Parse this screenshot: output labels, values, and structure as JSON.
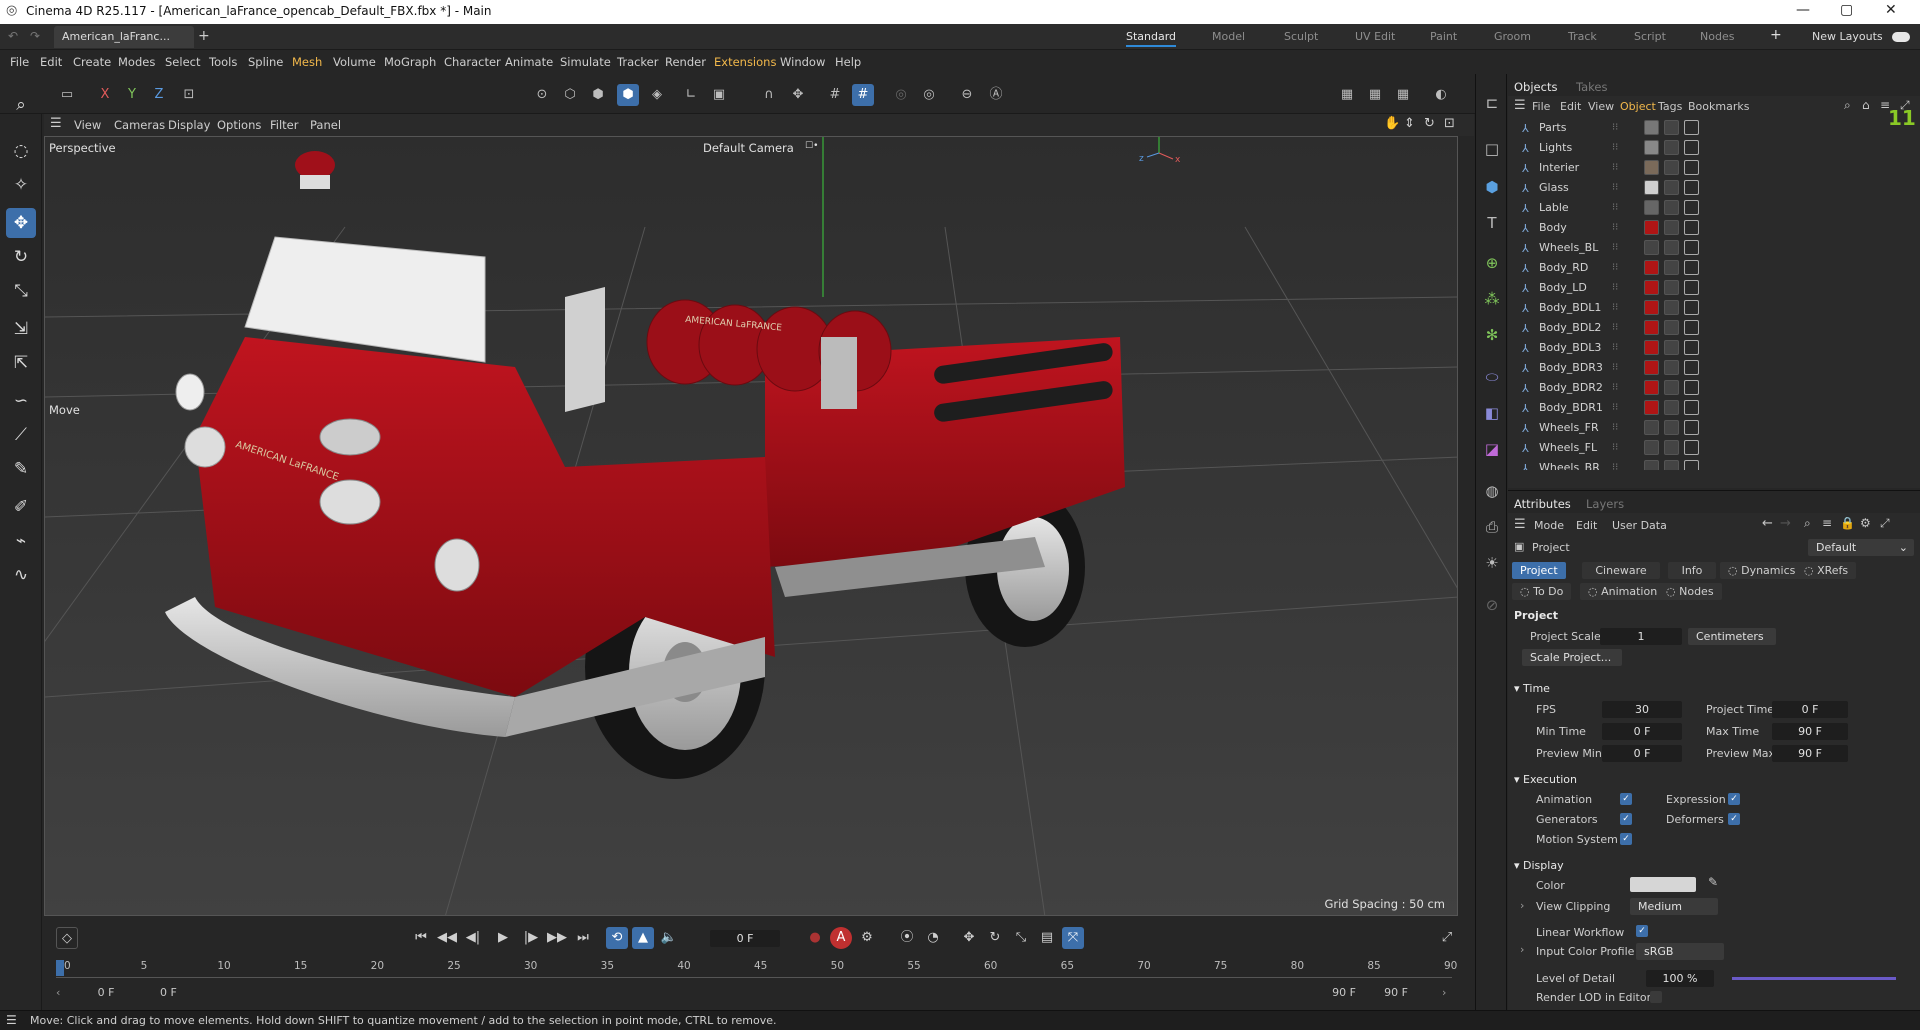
{
  "window": {
    "title": "Cinema 4D R25.117 - [American_laFrance_opencab_Default_FBX.fbx *] - Main",
    "minimize": "—",
    "maximize": "▢",
    "close": "✕"
  },
  "doc_tab": {
    "label": "American_laFranc...",
    "add": "+"
  },
  "layouts": [
    "Standard",
    "Model",
    "Sculpt",
    "UV Edit",
    "Paint",
    "Groom",
    "Track",
    "Script",
    "Nodes"
  ],
  "layouts_add": "+",
  "new_layouts": "New Layouts",
  "menu": [
    "File",
    "Edit",
    "Create",
    "Modes",
    "Select",
    "Tools",
    "Spline",
    "Mesh",
    "Volume",
    "MoGraph",
    "Character",
    "Animate",
    "Simulate",
    "Tracker",
    "Render",
    "Extensions",
    "Window",
    "Help"
  ],
  "axis_toolbar": {
    "x": "X",
    "y": "Y",
    "z": "Z"
  },
  "viewport_menu": [
    "View",
    "Cameras",
    "Display",
    "Options",
    "Filter",
    "Panel"
  ],
  "viewport": {
    "projection": "Perspective",
    "camera": "Default Camera",
    "camera_icon": "☐•",
    "tool_label": "Move",
    "grid_spacing": "Grid Spacing : 50 cm",
    "axis_x": "x",
    "axis_y": "y",
    "axis_z": "z",
    "truck_text": "AMERICAN LaFRANCE",
    "truck_text_small": "AMERICAN LaFRANCE"
  },
  "timeline": {
    "current_frame": "0 F",
    "start_field": "0 F",
    "start_field2": "0 F",
    "end_field": "90 F",
    "end_field2": "90 F",
    "ticks": [
      "0",
      "5",
      "10",
      "15",
      "20",
      "25",
      "30",
      "35",
      "40",
      "45",
      "50",
      "55",
      "60",
      "65",
      "70",
      "75",
      "80",
      "85",
      "90"
    ]
  },
  "status": "Move: Click and drag to move elements. Hold down SHIFT to quantize movement / add to the selection in point mode, CTRL to remove.",
  "objects_panel": {
    "tabs": [
      "Objects",
      "Takes"
    ],
    "menu": [
      "File",
      "Edit",
      "View",
      "Object",
      "Tags",
      "Bookmarks"
    ],
    "count": "11",
    "items": [
      {
        "name": "Parts",
        "tag": "#777"
      },
      {
        "name": "Lights",
        "tag": "#888"
      },
      {
        "name": "Interier",
        "tag": "#7a6a5a"
      },
      {
        "name": "Glass",
        "tag": "#cfcfcf"
      },
      {
        "name": "Lable",
        "tag": "#666"
      },
      {
        "name": "Body",
        "tag": "#b01515"
      },
      {
        "name": "Wheels_BL",
        "tag": "#444"
      },
      {
        "name": "Body_RD",
        "tag": "#b01515"
      },
      {
        "name": "Body_LD",
        "tag": "#b01515"
      },
      {
        "name": "Body_BDL1",
        "tag": "#b01515"
      },
      {
        "name": "Body_BDL2",
        "tag": "#b01515"
      },
      {
        "name": "Body_BDL3",
        "tag": "#b01515"
      },
      {
        "name": "Body_BDR3",
        "tag": "#b01515"
      },
      {
        "name": "Body_BDR2",
        "tag": "#b01515"
      },
      {
        "name": "Body_BDR1",
        "tag": "#b01515"
      },
      {
        "name": "Wheels_FR",
        "tag": "#444"
      },
      {
        "name": "Wheels_FL",
        "tag": "#444"
      },
      {
        "name": "Wheels_BR",
        "tag": "#444"
      }
    ]
  },
  "attributes_panel": {
    "tabs": [
      "Attributes",
      "Layers"
    ],
    "menu": [
      "Mode",
      "Edit",
      "User Data"
    ],
    "object_name": "Project",
    "preset": "Default",
    "subtabs_row1": [
      "Project",
      "Cineware",
      "Info",
      "Dynamics",
      "XRefs"
    ],
    "subtabs_row2": [
      "To Do",
      "Animation",
      "Nodes"
    ],
    "section_project": "Project",
    "project_scale_label": "Project Scale",
    "project_scale_value": "1",
    "project_scale_unit": "Centimeters",
    "scale_project_button": "Scale Project...",
    "section_time": "Time",
    "fps_label": "FPS",
    "fps_value": "30",
    "project_time_label": "Project Time",
    "project_time_value": "0 F",
    "min_time_label": "Min Time",
    "min_time_value": "0 F",
    "max_time_label": "Max Time",
    "max_time_value": "90 F",
    "preview_min_label": "Preview Min",
    "preview_min_value": "0 F",
    "preview_max_label": "Preview Max",
    "preview_max_value": "90 F",
    "section_execution": "Execution",
    "animation_label": "Animation",
    "expression_label": "Expression",
    "generators_label": "Generators",
    "deformers_label": "Deformers",
    "motion_system_label": "Motion System",
    "section_display": "Display",
    "color_label": "Color",
    "view_clipping_label": "View Clipping",
    "view_clipping_value": "Medium",
    "linear_workflow_label": "Linear Workflow",
    "input_color_profile_label": "Input Color Profile",
    "input_color_profile_value": "sRGB",
    "level_of_detail_label": "Level of Detail",
    "level_of_detail_value": "100 %",
    "render_lod_label": "Render LOD in Editor"
  },
  "colors": {
    "accent": "#3d6faa",
    "truck_red": "#a0101a",
    "menu_highlight": "#f2b84b",
    "object_count": "#8ac926"
  }
}
